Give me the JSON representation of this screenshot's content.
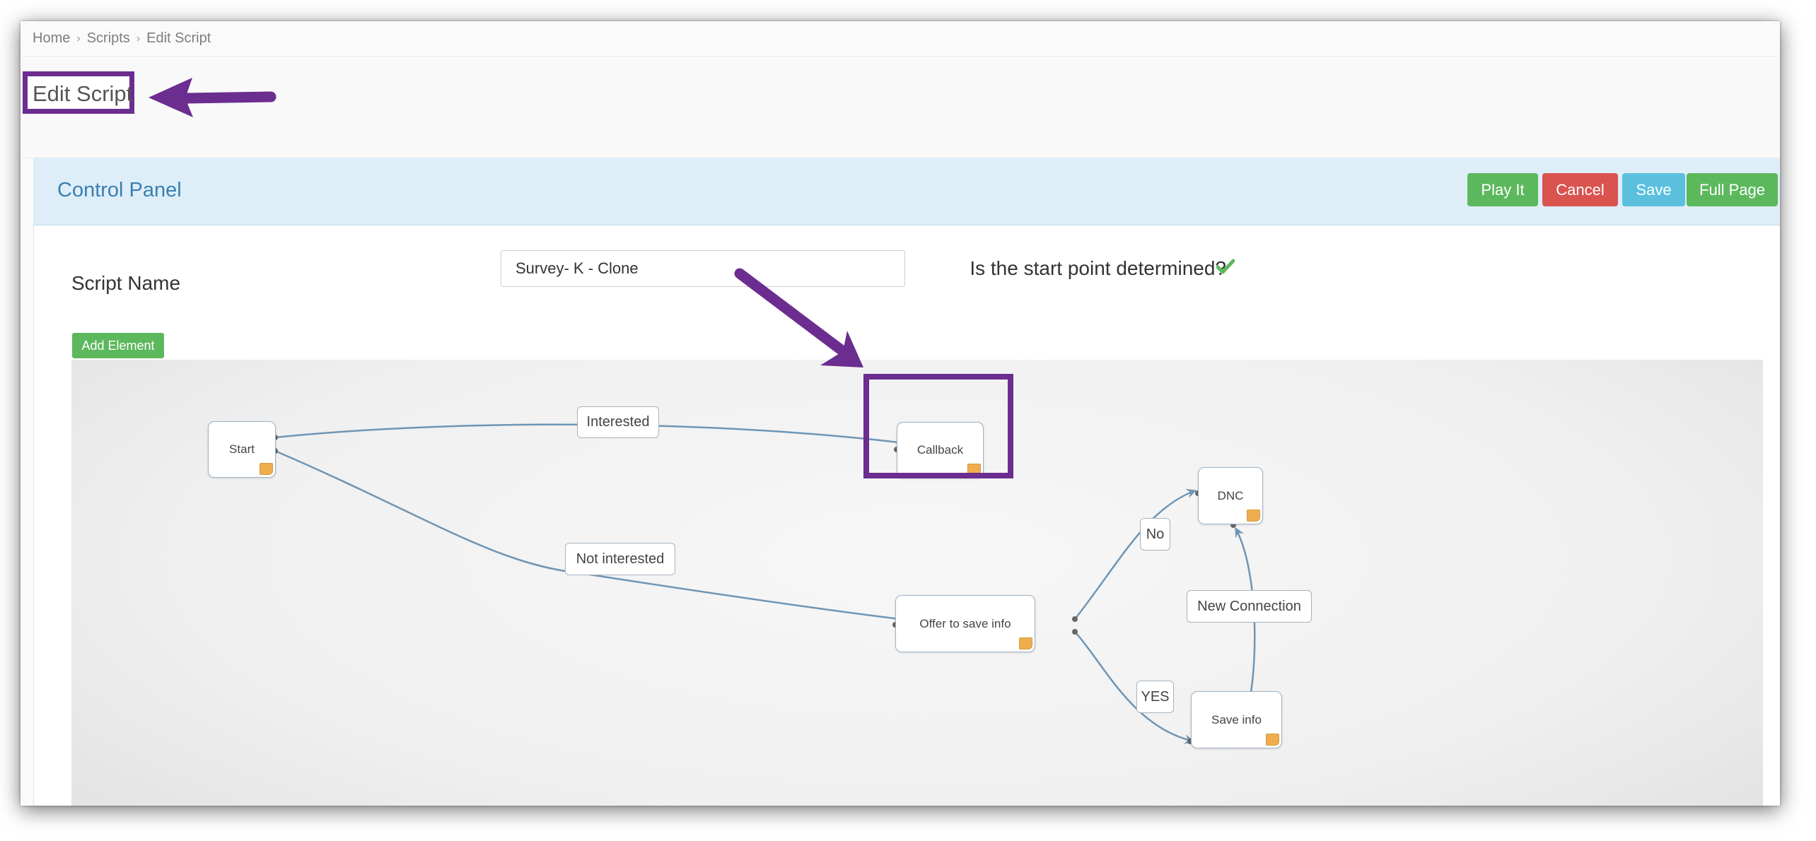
{
  "breadcrumb": {
    "home": "Home",
    "scripts": "Scripts",
    "current": "Edit Script",
    "separator": "›"
  },
  "page": {
    "title": "Edit Script"
  },
  "panel": {
    "title": "Control Panel",
    "buttons": {
      "play": "Play It",
      "cancel": "Cancel",
      "save": "Save",
      "full_page": "Full Page"
    }
  },
  "form": {
    "script_name_label": "Script Name",
    "script_name_value": "Survey- K - Clone",
    "start_point_question": "Is the start point determined?",
    "start_point_determined": true,
    "add_element_label": "Add Element"
  },
  "flow": {
    "nodes": {
      "start": "Start",
      "callback": "Callback",
      "dnc": "DNC",
      "offer": "Offer to save info",
      "save_info": "Save info"
    },
    "edges": {
      "interested": "Interested",
      "not_interested": "Not interested",
      "no": "No",
      "yes": "YES",
      "new_connection": "New Connection"
    }
  },
  "colors": {
    "highlight": "#6b2d8f",
    "success": "#5cb85c",
    "danger": "#d9534f",
    "info": "#5bc0de",
    "edge": "#6f95b4",
    "note": "#f0ad4e",
    "panel_heading": "#deeef8"
  },
  "icons": {
    "check": "check-icon",
    "note": "note-icon"
  }
}
